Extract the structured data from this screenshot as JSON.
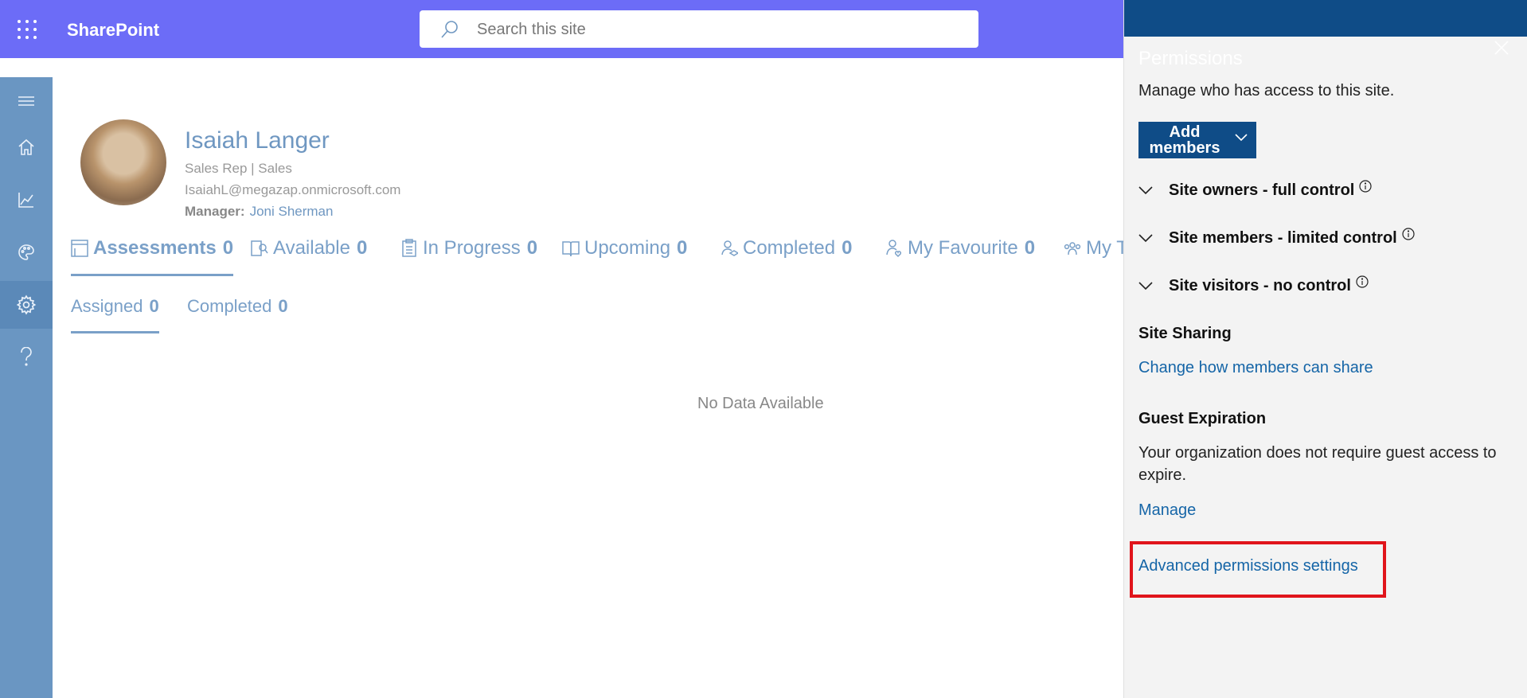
{
  "suite": {
    "app_title": "SharePoint",
    "search_placeholder": "Search this site"
  },
  "left_rail": {
    "items": [
      {
        "icon": "hamburger-icon"
      },
      {
        "icon": "home-icon"
      },
      {
        "icon": "chart-icon"
      },
      {
        "icon": "palette-icon"
      },
      {
        "icon": "gear-icon",
        "active": true
      },
      {
        "icon": "help-icon"
      }
    ]
  },
  "profile": {
    "name": "Isaiah Langer",
    "role": "Sales Rep | Sales",
    "email": "IsaiahL@megazap.onmicrosoft.com",
    "manager_label": "Manager:",
    "manager_name": "Joni Sherman"
  },
  "tabs": [
    {
      "label": "Assessments",
      "count": "0",
      "icon": "assessment-icon",
      "active": true
    },
    {
      "label": "Available",
      "count": "0",
      "icon": "available-icon"
    },
    {
      "label": "In Progress",
      "count": "0",
      "icon": "clipboard-icon"
    },
    {
      "label": "Upcoming",
      "count": "0",
      "icon": "book-icon"
    },
    {
      "label": "Completed",
      "count": "0",
      "icon": "graduation-icon"
    },
    {
      "label": "My Favourite",
      "count": "0",
      "icon": "person-heart-icon"
    },
    {
      "label": "My T",
      "count": "",
      "icon": "team-icon"
    }
  ],
  "subtabs": [
    {
      "label": "Assigned",
      "count": "0",
      "active": true
    },
    {
      "label": "Completed",
      "count": "0"
    }
  ],
  "empty_state": "No Data Available",
  "panel": {
    "title": "Permissions",
    "subtitle": "Manage who has access to this site.",
    "add_members": "Add members",
    "groups": [
      {
        "label": "Site owners - full control"
      },
      {
        "label": "Site members - limited control"
      },
      {
        "label": "Site visitors - no control"
      }
    ],
    "site_sharing_heading": "Site Sharing",
    "site_sharing_link": "Change how members can share",
    "guest_heading": "Guest Expiration",
    "guest_text": "Your organization does not require guest access to expire.",
    "guest_link": "Manage",
    "advanced_link": "Advanced permissions settings"
  },
  "colors": {
    "suite_bar": "#6c6cf7",
    "panel_accent": "#0f4c87",
    "link": "#1565a7",
    "highlight": "#e0141b"
  }
}
